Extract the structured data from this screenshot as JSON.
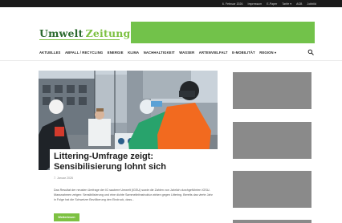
{
  "topbar": {
    "links": [
      "6. Februar 2026",
      "Impressum",
      "E-Paper",
      "Tarife ▾",
      "AGB",
      "Jobbild"
    ]
  },
  "header": {
    "logo_part1": "Umwelt",
    "logo_part2": "Zeitung",
    "brand_green": "#7dc142",
    "brand_dark_green": "#2b6a2e"
  },
  "nav": {
    "items": [
      "AKTUELLES",
      "ABFALL / RECYCLING",
      "ENERGIE",
      "KLIMA",
      "NACHHALTIGKEIT",
      "WASSER",
      "ARTENVIELFALT",
      "E-MOBILITÄT",
      "REGION ▾"
    ],
    "search_icon": "search-icon"
  },
  "article": {
    "title": "Littering-Umfrage zeigt: Sensibilisierung lohnt sich",
    "date": "7. Januar 2026",
    "excerpt": "Das Resultat der neusten Umfrage der IG saubere Umwelt (IGSU) sowie die Zahlen von Jahrlich durchgeführten IGSU-Massnahmen zeigen: Sensibilisierung und eine dichte Sammelinfrastruktur wirken gegen Littering. Bereits das vierte Jahr in Folge hat die Schweizer Bevölkerung den Eindruck, dass...",
    "more_label": "Weiterlesen"
  },
  "sidebar": {
    "ad_color": "#8a8a8a"
  }
}
